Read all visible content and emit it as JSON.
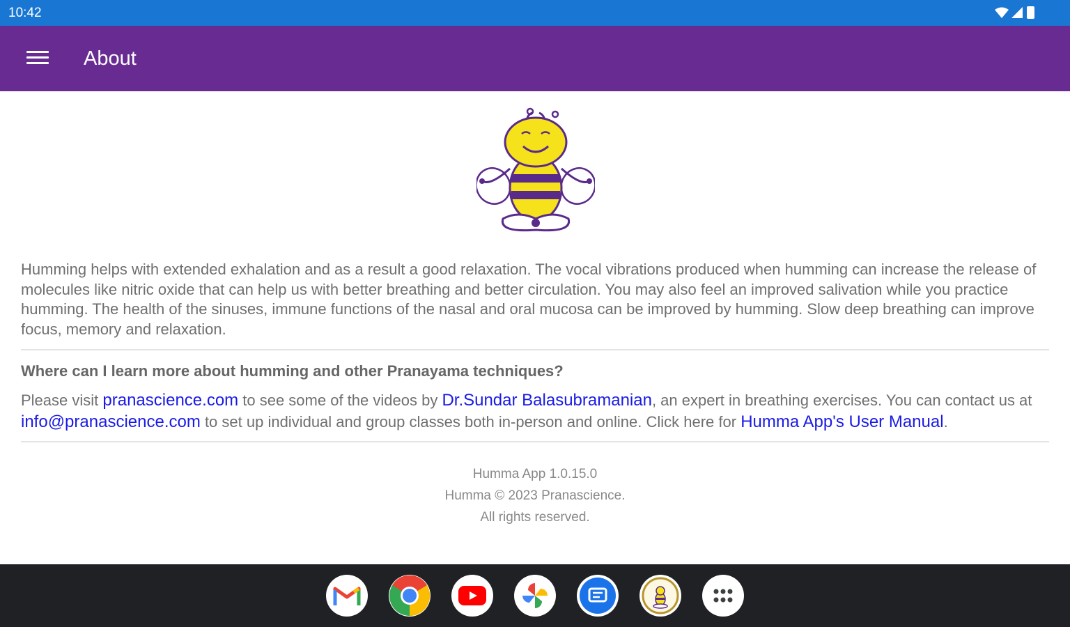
{
  "status_bar": {
    "time": "10:42",
    "background": "#1976d2"
  },
  "app_bar": {
    "title": "About",
    "menu_icon": "hamburger-menu-icon",
    "background": "#672b91"
  },
  "mascot": {
    "icon": "humming-bee-mascot"
  },
  "content": {
    "description": "Humming helps with extended exhalation and as a result a good relaxation. The vocal vibrations produced when humming can increase the release of molecules like nitric oxide that can help us with better breathing and better circulation. You may also feel an improved salivation while you practice humming. The health of the sinuses, immune functions of the nasal and oral mucosa can be improved by humming. Slow deep breathing can improve focus, memory and relaxation.",
    "question": "Where can I learn more about humming and other Pranayama techniques?",
    "visit": {
      "text1": "Please visit ",
      "link_site": "pranascience.com",
      "text2": " to see some of the videos by ",
      "link_doctor": "Dr.Sundar Balasubramanian",
      "text3": ", an expert in breathing exercises. You can contact us at ",
      "link_email": "info@pranascience.com",
      "text4": " to set up individual and group classes both in-person and online. Click here for ",
      "link_manual": "Humma App's User Manual",
      "text5": "."
    },
    "link_color": "#1a1ae6"
  },
  "footer": {
    "version": "Humma App 1.0.15.0",
    "copyright": "Humma © 2023 Pranascience.",
    "rights": "All rights reserved."
  },
  "dock": {
    "apps": [
      "gmail-icon",
      "chrome-icon",
      "youtube-icon",
      "photos-icon",
      "messages-icon",
      "humma-app-icon",
      "app-drawer-icon"
    ]
  }
}
